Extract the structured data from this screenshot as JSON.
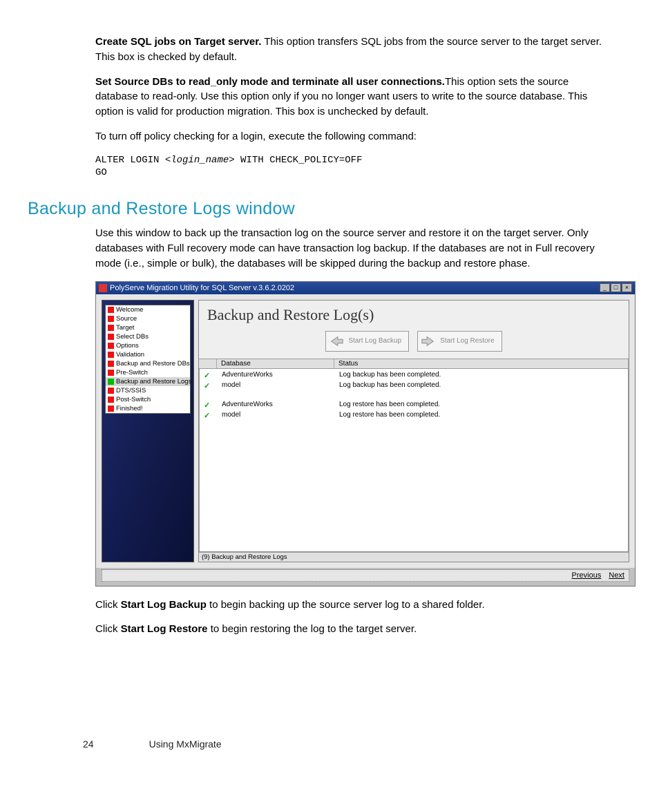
{
  "paragraphs": {
    "p1_bold": "Create SQL jobs on Target server.",
    "p1_rest": " This option transfers SQL jobs from the source server to the target server. This box is checked by default.",
    "p2_bold": "Set Source DBs to read_only mode and terminate all user connections.",
    "p2_rest": "This option sets the source database to read-only. Use this option only if you no longer want users to write to the source database. This option is valid for production migration. This box is unchecked by default.",
    "p3": "To turn off policy checking for a login, execute the following command:",
    "code_pre": "ALTER LOGIN ",
    "code_it": "<login_name>",
    "code_post": " WITH CHECK_POLICY=OFF",
    "code_line2": "GO",
    "heading": "Backup and Restore Logs window",
    "p4": "Use this window to back up the transaction log on the source server and restore it on the target server. Only databases with Full recovery mode can have transaction log backup. If the databases are not in Full recovery mode (i.e., simple or bulk), the databases will be skipped during the backup and restore phase.",
    "p5_a": "Click ",
    "p5_b": "Start Log Backup",
    "p5_c": " to begin backing up the source server log to a shared folder.",
    "p6_a": "Click ",
    "p6_b": "Start Log Restore",
    "p6_c": " to begin restoring the log to the target server."
  },
  "window": {
    "title": "PolyServe Migration Utility for SQL Server v.3.6.2.0202",
    "nav": [
      {
        "label": "Welcome",
        "sel": false,
        "g": false
      },
      {
        "label": "Source",
        "sel": false,
        "g": false
      },
      {
        "label": "Target",
        "sel": false,
        "g": false
      },
      {
        "label": "Select DBs",
        "sel": false,
        "g": false
      },
      {
        "label": "Options",
        "sel": false,
        "g": false
      },
      {
        "label": "Validation",
        "sel": false,
        "g": false
      },
      {
        "label": "Backup and Restore DBs",
        "sel": false,
        "g": false
      },
      {
        "label": "Pre-Switch",
        "sel": false,
        "g": false
      },
      {
        "label": "Backup and Restore Logs",
        "sel": true,
        "g": true
      },
      {
        "label": "DTS/SSIS",
        "sel": false,
        "g": false
      },
      {
        "label": "Post-Switch",
        "sel": false,
        "g": false
      },
      {
        "label": "Finished!",
        "sel": false,
        "g": false
      }
    ],
    "pane_title": "Backup and Restore Log(s)",
    "buttons": {
      "backup": "Start Log Backup",
      "restore": "Start Log Restore"
    },
    "columns": {
      "db": "Database",
      "status": "Status"
    },
    "rows": [
      {
        "db": "AdventureWorks",
        "status": "Log backup has been completed."
      },
      {
        "db": "model",
        "status": "Log backup has been completed."
      },
      {
        "db": "",
        "status": ""
      },
      {
        "db": "AdventureWorks",
        "status": "Log restore has been completed."
      },
      {
        "db": "model",
        "status": "Log restore has been completed."
      }
    ],
    "statusbar": "(9) Backup and Restore Logs",
    "prev": "Previous",
    "next": "Next"
  },
  "footer": {
    "page": "24",
    "section": "Using MxMigrate"
  }
}
